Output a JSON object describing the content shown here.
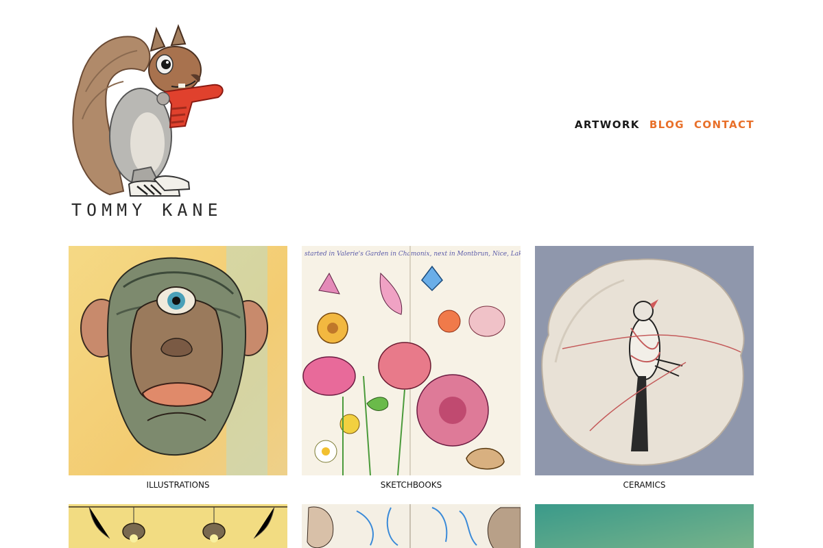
{
  "site": {
    "name": "TOMMY KANE"
  },
  "nav": {
    "items": [
      {
        "label": "ARTWORK",
        "state": "active"
      },
      {
        "label": "BLOG",
        "state": "link"
      },
      {
        "label": "CONTACT",
        "state": "link"
      }
    ],
    "accent_color": "#e8702a",
    "active_color": "#1a1a1a"
  },
  "gallery": {
    "items": [
      {
        "caption": "ILLUSTRATIONS",
        "image": "cyclops-chimp-illustration"
      },
      {
        "caption": "SKETCHBOOKS",
        "image": "flower-garden-sketchbook",
        "image_text": "started in Valerie's Garden in Chamonix, next in Montbrun, Nice, Lakes, CORK, and lily"
      },
      {
        "caption": "CERAMICS",
        "image": "bird-plate-ceramic"
      },
      {
        "caption": "",
        "image": "hanging-lamps-painting"
      },
      {
        "caption": "",
        "image": "portrait-sketches"
      },
      {
        "caption": "",
        "image": "teal-painting"
      }
    ]
  }
}
